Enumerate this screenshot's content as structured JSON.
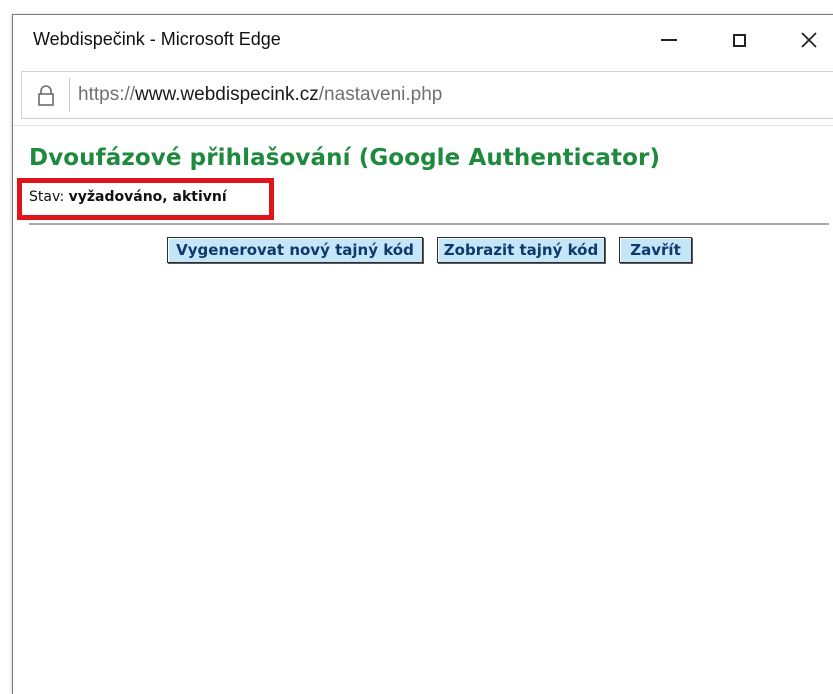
{
  "window": {
    "title": "Webdispečink - Microsoft Edge",
    "controls": {
      "minimize_icon": "minimize-icon",
      "maximize_icon": "maximize-icon",
      "close_icon": "close-icon"
    }
  },
  "address_bar": {
    "lock_icon": "lock-icon",
    "url_scheme": "https://",
    "url_domain": "www.webdispecink.cz",
    "url_path": "/nastaveni.php"
  },
  "page": {
    "heading": "Dvoufázové přihlašování (Google Authenticator)",
    "status_label": "Stav:",
    "status_value": "vyžadováno, aktivní",
    "highlight_color": "#e0141b",
    "heading_color": "#1d8a3e",
    "buttons": {
      "generate": "Vygenerovat nový tajný kód",
      "show": "Zobrazit tajný kód",
      "close": "Zavřít"
    }
  }
}
